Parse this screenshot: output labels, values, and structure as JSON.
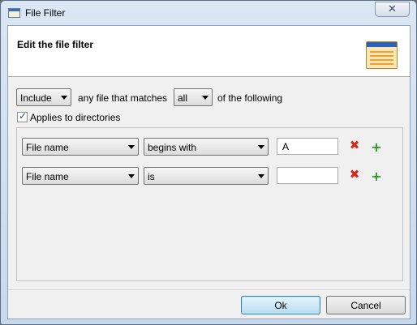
{
  "window": {
    "title": "File Filter"
  },
  "header": {
    "title": "Edit the file filter",
    "icon": "filter-list-icon"
  },
  "criteria": {
    "mode": "Include",
    "text_middle": "any file that matches",
    "match": "all",
    "text_end": "of the following",
    "applies_to_directories": {
      "label": "Applies to directories",
      "checked": true
    }
  },
  "rules": [
    {
      "attribute": "File name",
      "operator": "begins with",
      "value": "A"
    },
    {
      "attribute": "File name",
      "operator": "is",
      "value": ""
    }
  ],
  "buttons": {
    "ok": "Ok",
    "cancel": "Cancel"
  },
  "icons": {
    "close": "✕",
    "check": "✓",
    "remove": "✖",
    "add": "+"
  },
  "colors": {
    "remove": "#d42a1b",
    "add": "#2f9c2a",
    "accent": "#3c7fb1"
  }
}
